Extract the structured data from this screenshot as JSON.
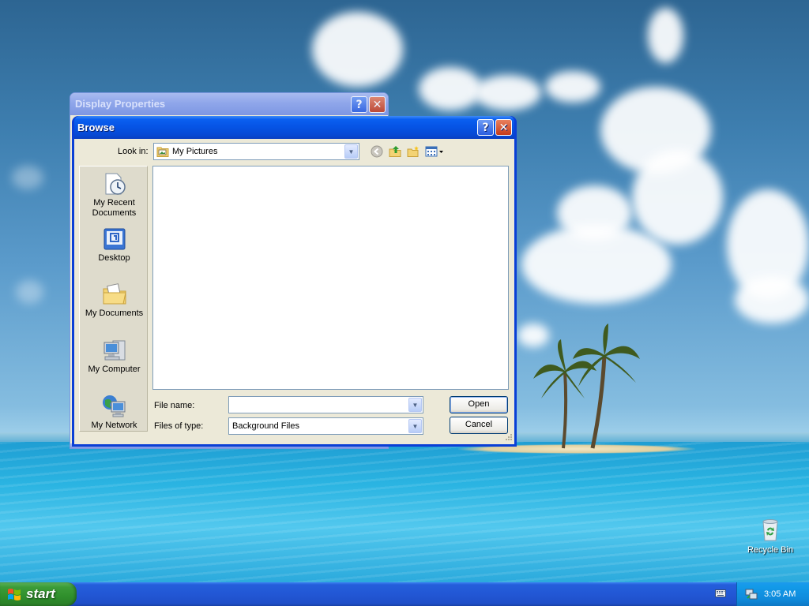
{
  "desktop": {
    "icons": [
      {
        "label": "Recycle Bin",
        "icon": "recycle-bin-icon"
      }
    ]
  },
  "parent_window": {
    "title": "Display Properties",
    "help_label": "?",
    "close_label": "✕"
  },
  "dialog": {
    "title": "Browse",
    "help_label": "?",
    "close_label": "✕",
    "look_in_label": "Look in:",
    "look_in_value": "My Pictures",
    "look_in_icon": "my-pictures-folder-icon",
    "toolbar": [
      "back-icon",
      "up-folder-icon",
      "new-folder-icon",
      "view-menu-icon"
    ],
    "places": [
      {
        "line1": "My Recent",
        "line2": "Documents",
        "icon": "recent-documents-icon"
      },
      {
        "line1": "Desktop",
        "line2": "",
        "icon": "desktop-icon"
      },
      {
        "line1": "My Documents",
        "line2": "",
        "icon": "my-documents-icon"
      },
      {
        "line1": "My Computer",
        "line2": "",
        "icon": "my-computer-icon"
      },
      {
        "line1": "My Network",
        "line2": "",
        "icon": "my-network-icon"
      }
    ],
    "file_name_label": "File name:",
    "file_name_value": "",
    "file_type_label": "Files of type:",
    "file_type_value": "Background Files",
    "open_label": "Open",
    "cancel_label": "Cancel"
  },
  "taskbar": {
    "start_label": "start",
    "clock": "3:05 AM",
    "tray_icons": [
      "network-icon"
    ],
    "language_icon": "keyboard-icon"
  },
  "colors": {
    "title_active": "#0653e4",
    "title_inactive": "#8fa6ea",
    "dialog_face": "#ece9d8",
    "taskbar": "#245edb",
    "start_green": "#3c9c38",
    "tray": "#129ae8"
  }
}
